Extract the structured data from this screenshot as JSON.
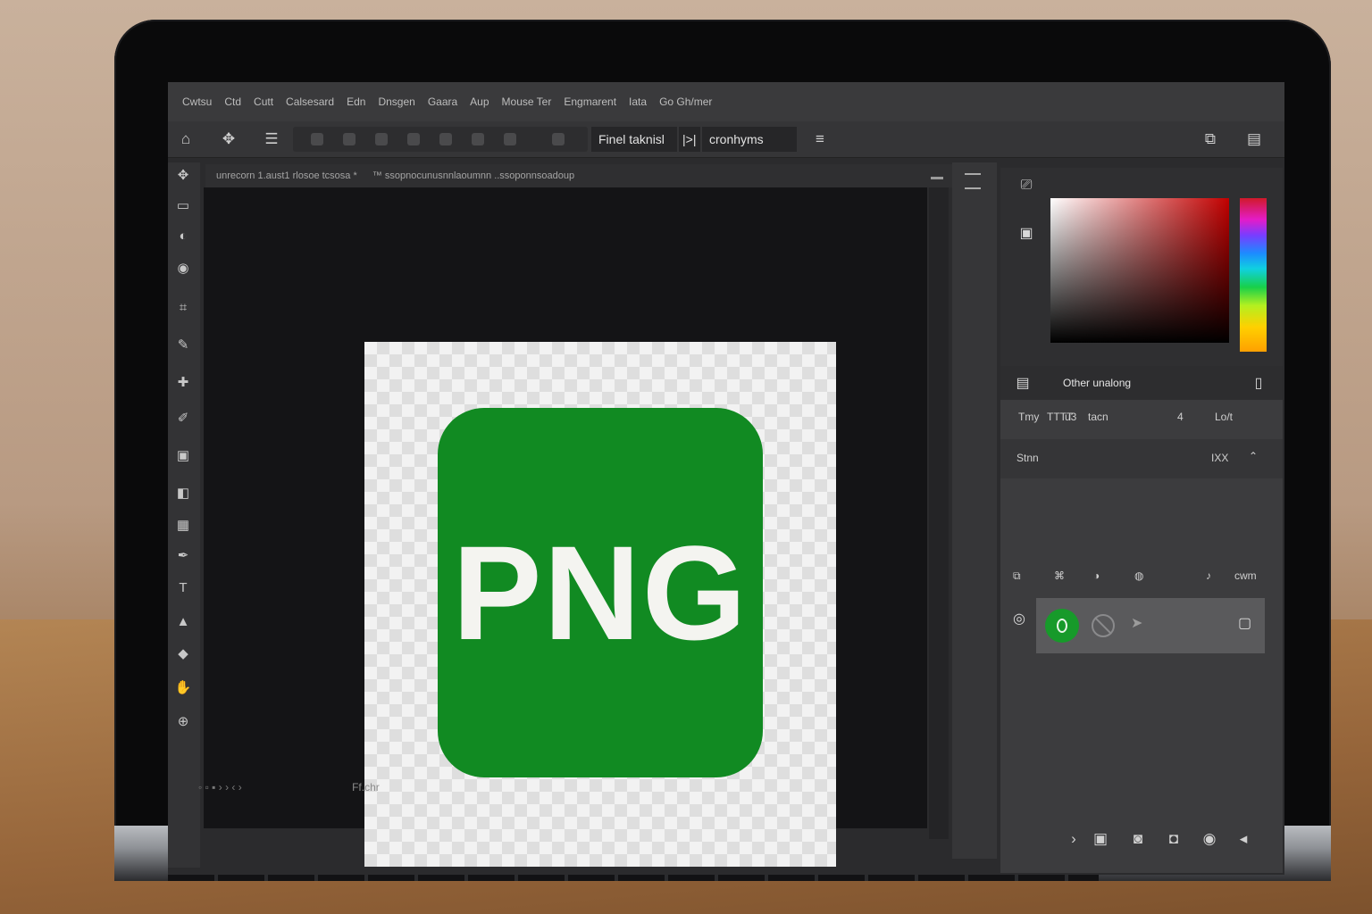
{
  "menubar": {
    "items": [
      "Cwtsu",
      "Ctd",
      "Cutt",
      "Calsesard",
      "Edn",
      "Dnsgen",
      "Gaara",
      "Aup",
      "Mouse Ter",
      "Engmarent",
      "Iata",
      "Go Gh/mer"
    ]
  },
  "options": {
    "field_a": "Finel taknisl",
    "separator": "|>|",
    "field_b": "cronhyms"
  },
  "document": {
    "tab_title": "unrecorn 1.aust1 rlosoe tcsosa *",
    "tab_path": "™ ssopnocunusnnlaoumnn ..ssoponnsoadoup",
    "artwork_text": "PNG",
    "status_text": "Ff.chr"
  },
  "panels": {
    "swatches_header": "Other unalong",
    "properties_row": {
      "a": "Tmy",
      "b": "TTTT",
      "c": "u3",
      "d": "tacn",
      "e": "4",
      "f": "Lo/t"
    },
    "style_row": {
      "label": "Stnn",
      "value": "IXX"
    },
    "layers_toolbar_label": "cwm"
  },
  "icons": {
    "search": "search-icon",
    "layer_visibility": "eye-icon"
  },
  "colors": {
    "brand_green": "#118a22",
    "selection_red": "#c20000"
  }
}
